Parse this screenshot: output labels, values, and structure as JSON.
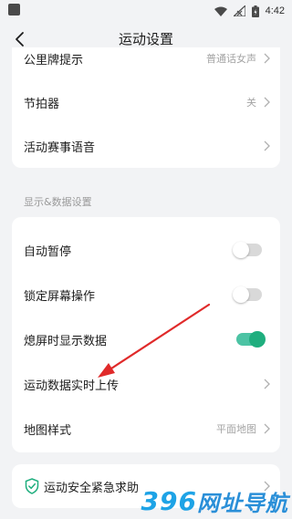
{
  "status_bar": {
    "time": "4:42"
  },
  "header": {
    "title": "运动设置"
  },
  "top_card": {
    "rows": [
      {
        "label": "公里牌提示",
        "value": "普通话女声"
      },
      {
        "label": "节拍器",
        "value": "关"
      },
      {
        "label": "活动赛事语音",
        "value": ""
      }
    ]
  },
  "section": {
    "title": "显示&数据设置"
  },
  "display_card": {
    "rows": [
      {
        "label": "自动暂停",
        "toggle": "off"
      },
      {
        "label": "锁定屏幕操作",
        "toggle": "off"
      },
      {
        "label": "熄屏时显示数据",
        "toggle": "on"
      },
      {
        "label": "运动数据实时上传",
        "value": ""
      },
      {
        "label": "地图样式",
        "value": "平面地图"
      }
    ]
  },
  "bottom_card": {
    "label": "运动安全紧急求助"
  },
  "watermark": {
    "text_num": "396",
    "text_cn": "网址导航"
  },
  "colors": {
    "accent": "#1fae7e",
    "annotation_arrow": "#e02a2a",
    "watermark": "#1ea3e6"
  }
}
